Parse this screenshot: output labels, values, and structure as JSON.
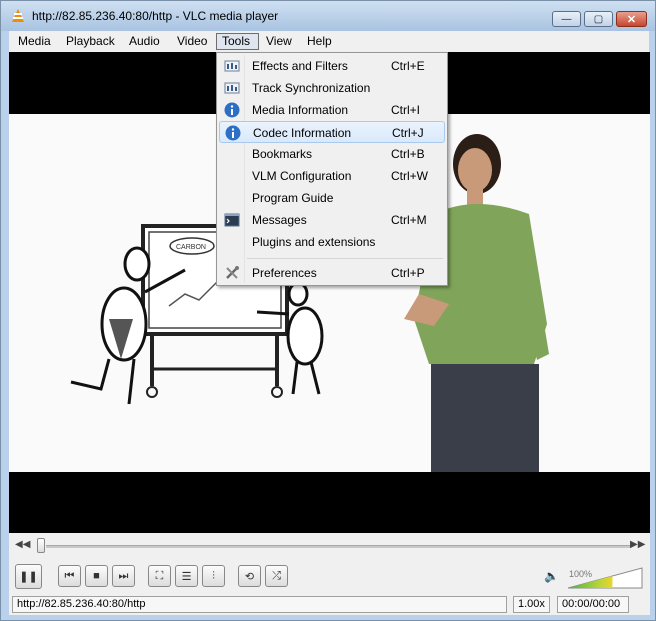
{
  "window": {
    "title": "http://82.85.236.40:80/http - VLC media player",
    "min_glyph": "—",
    "max_glyph": "▢",
    "close_glyph": "✕"
  },
  "menubar": {
    "items": [
      {
        "label": "Media"
      },
      {
        "label": "Playback"
      },
      {
        "label": "Audio"
      },
      {
        "label": "Video"
      },
      {
        "label": "Tools"
      },
      {
        "label": "View"
      },
      {
        "label": "Help"
      }
    ],
    "active": "Tools"
  },
  "tools_menu": {
    "items": [
      {
        "label": "Effects and Filters",
        "shortcut": "Ctrl+E",
        "icon": "equalizer-icon"
      },
      {
        "label": "Track Synchronization",
        "shortcut": "",
        "icon": "equalizer-icon"
      },
      {
        "label": "Media Information",
        "shortcut": "Ctrl+I",
        "icon": "info-icon"
      },
      {
        "label": "Codec Information",
        "shortcut": "Ctrl+J",
        "icon": "info-icon",
        "highlighted": true
      },
      {
        "label": "Bookmarks",
        "shortcut": "Ctrl+B",
        "icon": ""
      },
      {
        "label": "VLM Configuration",
        "shortcut": "Ctrl+W",
        "icon": ""
      },
      {
        "label": "Program Guide",
        "shortcut": "",
        "icon": ""
      },
      {
        "label": "Messages",
        "shortcut": "Ctrl+M",
        "icon": "terminal-icon"
      },
      {
        "label": "Plugins and extensions",
        "shortcut": "",
        "icon": ""
      },
      {
        "label": "Preferences",
        "shortcut": "Ctrl+P",
        "icon": "tools-icon"
      }
    ]
  },
  "video": {
    "whiteboard_text": "CARBON"
  },
  "controls": {
    "seek_back_glyph": "◀◀",
    "seek_fwd_glyph": "▶▶",
    "seek_position": 0.0,
    "buttons": [
      {
        "icon": "pause-icon",
        "glyph": "❚❚"
      },
      {
        "icon": "previous-icon",
        "glyph": "⏮"
      },
      {
        "icon": "stop-icon",
        "glyph": "■"
      },
      {
        "icon": "next-icon",
        "glyph": "⏭"
      },
      {
        "icon": "fullscreen-icon",
        "glyph": "⛶"
      },
      {
        "icon": "playlist-icon",
        "glyph": "☰"
      },
      {
        "icon": "extended-settings-icon",
        "glyph": "⫶"
      },
      {
        "icon": "loop-icon",
        "glyph": "⟲"
      },
      {
        "icon": "shuffle-icon",
        "glyph": "⤮"
      }
    ],
    "volume_glyph": "🔈",
    "volume_label": "100%",
    "volume_level": 1.0
  },
  "statusbar": {
    "url": "http://82.85.236.40:80/http",
    "speed": "1.00x",
    "time": "00:00/00:00"
  },
  "colors": {
    "menu_highlight": "#d9e9fb",
    "info_blue": "#2c6fc4",
    "volume_green": "#46b53f",
    "volume_yellow": "#e8d52c"
  }
}
